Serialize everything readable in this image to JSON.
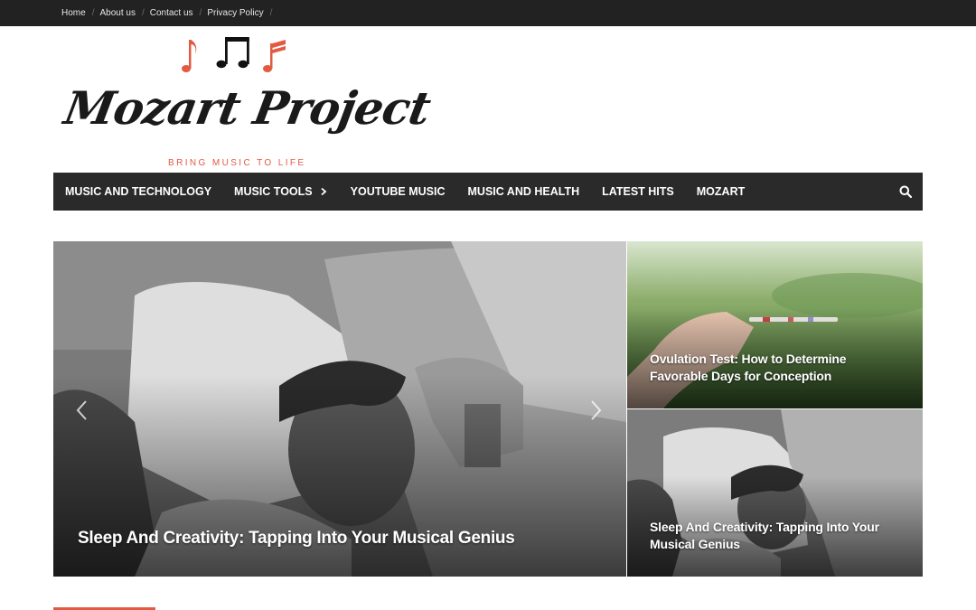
{
  "top_nav": {
    "items": [
      "Home",
      "About us",
      "Contact us",
      "Privacy Policy"
    ],
    "separator": "/"
  },
  "logo": {
    "title": "Mozart Project",
    "tagline": "BRING MUSIC TO LIFE",
    "note_colors": [
      "#e35a43",
      "#111111",
      "#e35a43"
    ]
  },
  "main_nav": {
    "items": [
      {
        "label": "MUSIC AND TECHNOLOGY",
        "has_submenu": false
      },
      {
        "label": "MUSIC TOOLS",
        "has_submenu": true
      },
      {
        "label": "YOUTUBE MUSIC",
        "has_submenu": false
      },
      {
        "label": "MUSIC AND HEALTH",
        "has_submenu": false
      },
      {
        "label": "LATEST HITS",
        "has_submenu": false
      },
      {
        "label": "MOZART",
        "has_submenu": false
      }
    ],
    "search_icon": "search-icon"
  },
  "featured": {
    "main": {
      "title": "Sleep And Creativity: Tapping Into Your Musical Genius"
    },
    "side": [
      {
        "title": "Ovulation Test: How to Determine Favorable Days for Conception"
      },
      {
        "title": "Sleep And Creativity: Tapping Into Your Musical Genius"
      }
    ]
  },
  "colors": {
    "accent": "#e35a43",
    "topbar_bg": "#222222",
    "nav_bg": "#2a2a2a"
  }
}
